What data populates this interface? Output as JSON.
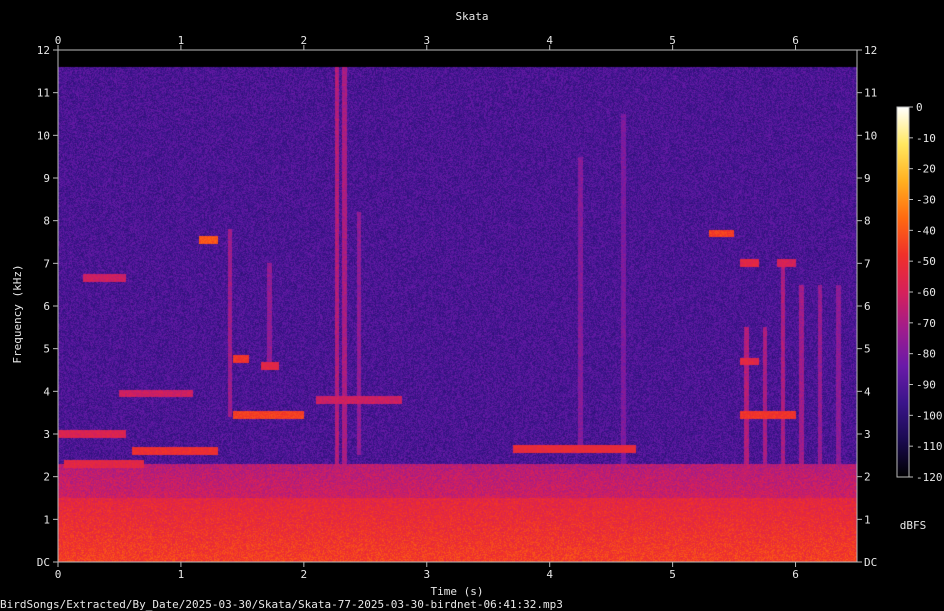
{
  "chart_data": {
    "type": "heatmap",
    "title": "Skata",
    "xlabel": "Time (s)",
    "ylabel": "Frequency (kHz)",
    "xlim": [
      0,
      6.5
    ],
    "ylim": [
      0,
      12
    ],
    "x_ticks": [
      "0",
      "1",
      "2",
      "3",
      "4",
      "5",
      "6"
    ],
    "y_ticks": [
      "DC",
      "1",
      "2",
      "3",
      "4",
      "5",
      "6",
      "7",
      "8",
      "9",
      "10",
      "11",
      "12"
    ],
    "spectrum_upper_limit_khz": 11.6,
    "colorbar": {
      "label": "dBFS",
      "range": [
        -120,
        0
      ],
      "ticks": [
        "0",
        "-10",
        "-20",
        "-30",
        "-40",
        "-50",
        "-60",
        "-70",
        "-80",
        "-90",
        "-100",
        "-110",
        "-120"
      ],
      "colors": [
        "#000000",
        "#1a0a50",
        "#3a148a",
        "#6a1aa8",
        "#a01c8c",
        "#d6205a",
        "#f0302a",
        "#ff6a10",
        "#ffb020",
        "#ffe860",
        "#ffffff"
      ]
    },
    "grid": false,
    "legend": "right",
    "features": [
      {
        "kind": "band",
        "t": [
          0,
          6.5
        ],
        "f": [
          0,
          1.5
        ],
        "db": -45
      },
      {
        "kind": "band",
        "t": [
          0,
          6.5
        ],
        "f": [
          1.5,
          2.3
        ],
        "db": -62
      },
      {
        "kind": "tone",
        "t": [
          0.0,
          0.55
        ],
        "f": 3.0,
        "db": -58
      },
      {
        "kind": "tone",
        "t": [
          0.05,
          0.7
        ],
        "f": 2.3,
        "db": -55
      },
      {
        "kind": "tone",
        "t": [
          0.2,
          0.55
        ],
        "f": 6.65,
        "db": -62
      },
      {
        "kind": "tone",
        "t": [
          0.5,
          1.1
        ],
        "f": 3.95,
        "db": -62
      },
      {
        "kind": "tone",
        "t": [
          0.6,
          1.3
        ],
        "f": 2.6,
        "db": -50
      },
      {
        "kind": "tone",
        "t": [
          1.15,
          1.3
        ],
        "f": 7.55,
        "db": -40
      },
      {
        "kind": "tone",
        "t": [
          1.42,
          1.55
        ],
        "f": 4.75,
        "db": -48
      },
      {
        "kind": "tone",
        "t": [
          1.42,
          2.0
        ],
        "f": 3.45,
        "db": -45
      },
      {
        "kind": "tone",
        "t": [
          1.65,
          1.8
        ],
        "f": 4.6,
        "db": -55
      },
      {
        "kind": "tone",
        "t": [
          2.1,
          2.8
        ],
        "f": 3.8,
        "db": -62
      },
      {
        "kind": "tone",
        "t": [
          3.7,
          4.7
        ],
        "f": 2.65,
        "db": -52
      },
      {
        "kind": "tone",
        "t": [
          5.3,
          5.5
        ],
        "f": 7.7,
        "db": -45
      },
      {
        "kind": "tone",
        "t": [
          5.55,
          6.0
        ],
        "f": 3.45,
        "db": -48
      },
      {
        "kind": "tone",
        "t": [
          5.55,
          5.7
        ],
        "f": 4.7,
        "db": -55
      },
      {
        "kind": "tone",
        "t": [
          5.55,
          5.7
        ],
        "f": 7.0,
        "db": -55
      },
      {
        "kind": "tone",
        "t": [
          5.85,
          6.0
        ],
        "f": 7.0,
        "db": -60
      },
      {
        "kind": "click",
        "t": 2.27,
        "f": [
          0.2,
          11.6
        ],
        "db": -68
      },
      {
        "kind": "click",
        "t": 2.33,
        "f": [
          0.2,
          11.6
        ],
        "db": -70
      },
      {
        "kind": "click",
        "t": 2.45,
        "f": [
          2.5,
          8.2
        ],
        "db": -75
      },
      {
        "kind": "click",
        "t": 1.4,
        "f": [
          3.4,
          7.8
        ],
        "db": -72
      },
      {
        "kind": "click",
        "t": 1.72,
        "f": [
          4.5,
          7.0
        ],
        "db": -75
      },
      {
        "kind": "click",
        "t": 4.25,
        "f": [
          2.6,
          9.5
        ],
        "db": -78
      },
      {
        "kind": "click",
        "t": 4.6,
        "f": [
          2.0,
          10.5
        ],
        "db": -80
      },
      {
        "kind": "click",
        "t": 5.6,
        "f": [
          2.0,
          5.5
        ],
        "db": -68
      },
      {
        "kind": "click",
        "t": 5.75,
        "f": [
          2.0,
          5.5
        ],
        "db": -70
      },
      {
        "kind": "click",
        "t": 5.9,
        "f": [
          2.0,
          7.0
        ],
        "db": -70
      },
      {
        "kind": "click",
        "t": 6.05,
        "f": [
          2.0,
          6.5
        ],
        "db": -72
      },
      {
        "kind": "click",
        "t": 6.2,
        "f": [
          2.0,
          6.5
        ],
        "db": -74
      },
      {
        "kind": "click",
        "t": 6.35,
        "f": [
          2.0,
          6.5
        ],
        "db": -76
      }
    ]
  },
  "footer": {
    "path": "BirdSongs/Extracted/By_Date/2025-03-30/Skata/Skata-77-2025-03-30-birdnet-06:41:32.mp3"
  }
}
